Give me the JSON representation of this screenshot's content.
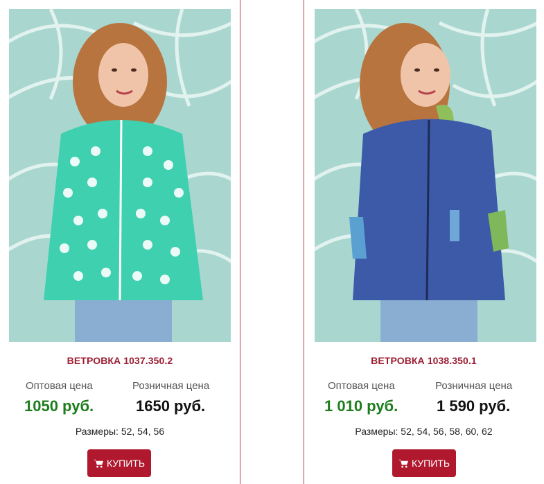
{
  "products": [
    {
      "title": "ВЕТРОВКА 1037.350.2",
      "wholesale_label": "Оптовая цена",
      "wholesale_price": "1050 руб.",
      "retail_label": "Розничная цена",
      "retail_price": "1650 руб.",
      "sizes": "Размеры: 52, 54, 56",
      "buy_label": "КУПИТЬ",
      "jacket_color": "#3fd0b0"
    },
    {
      "title": "ВЕТРОВКА 1038.350.1",
      "wholesale_label": "Оптовая цена",
      "wholesale_price": "1 010 руб.",
      "retail_label": "Розничная цена",
      "retail_price": "1 590 руб.",
      "sizes": "Размеры: 52, 54, 56, 58, 60, 62",
      "buy_label": "КУПИТЬ",
      "jacket_color": "#3c5aa8"
    }
  ],
  "colors": {
    "title": "#9b1c30",
    "wholesale": "#1d7d1d",
    "button": "#b0182e",
    "border": "#b3434f"
  },
  "icons": {
    "buy": "shopping-cart-icon"
  }
}
